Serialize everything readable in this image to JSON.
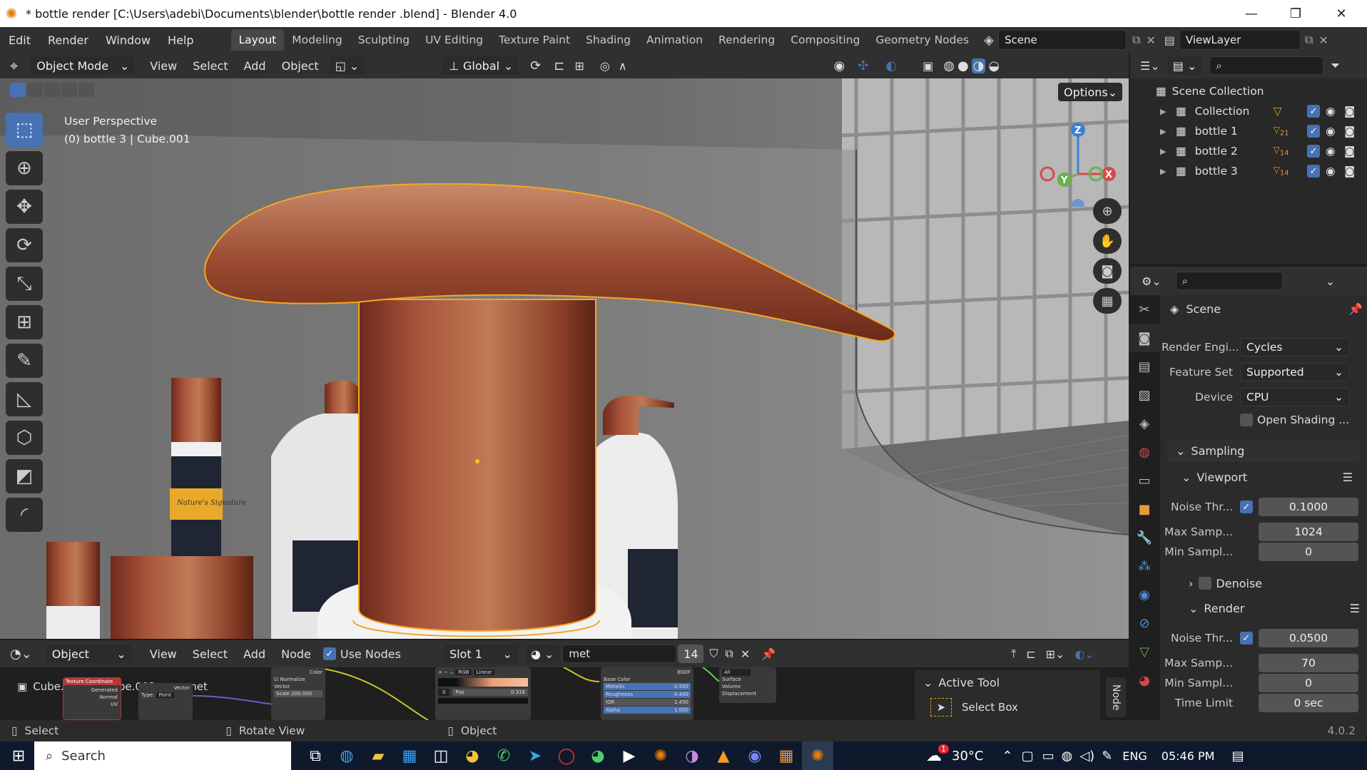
{
  "window": {
    "title": "* bottle render  [C:\\Users\\adebi\\Documents\\blender\\bottle render .blend] - Blender 4.0",
    "minimize": "—",
    "maximize": "❐",
    "close": "✕"
  },
  "menu": [
    "Edit",
    "Render",
    "Window",
    "Help"
  ],
  "workspaces": [
    "Layout",
    "Modeling",
    "Sculpting",
    "UV Editing",
    "Texture Paint",
    "Shading",
    "Animation",
    "Rendering",
    "Compositing",
    "Geometry Nodes"
  ],
  "scene_field": "Scene",
  "viewlayer_field": "ViewLayer",
  "viewport_header": {
    "mode": "Object Mode",
    "menus": [
      "View",
      "Select",
      "Add",
      "Object"
    ],
    "transform": "Global",
    "options": "Options"
  },
  "viewport": {
    "perspective": "User Perspective",
    "object_info": "(0) bottle 3  | Cube.001",
    "gizmo_z": "Z",
    "gizmo_y": "Y",
    "gizmo_x": "X",
    "label_text": "Nature's Signature"
  },
  "outliner": {
    "root": "Scene Collection",
    "items": [
      {
        "name": "Collection",
        "badge": ""
      },
      {
        "name": "bottle 1",
        "badge": "21"
      },
      {
        "name": "bottle 2",
        "badge": "14"
      },
      {
        "name": "bottle 3",
        "badge": "14"
      }
    ]
  },
  "properties": {
    "context": "Scene",
    "render_engine_label": "Render Engi...",
    "render_engine": "Cycles",
    "feature_set_label": "Feature Set",
    "feature_set": "Supported",
    "device_label": "Device",
    "device": "CPU",
    "osl_label": "Open Shading ...",
    "sampling": "Sampling",
    "viewport_panel": "Viewport",
    "vp_noise_label": "Noise Thr...",
    "vp_noise": "0.1000",
    "vp_max_label": "Max Samp...",
    "vp_max": "1024",
    "vp_min_label": "Min Sampl...",
    "vp_min": "0",
    "denoise": "Denoise",
    "render_panel": "Render",
    "r_noise_label": "Noise Thr...",
    "r_noise": "0.0500",
    "r_max_label": "Max Samp...",
    "r_max": "70",
    "r_min_label": "Min Sampl...",
    "r_min": "0",
    "time_label": "Time Limit",
    "time": "0 sec"
  },
  "node_header": {
    "type": "Object",
    "menus": [
      "View",
      "Select",
      "Add",
      "Node"
    ],
    "use_nodes": "Use Nodes",
    "slot": "Slot 1",
    "material": "met",
    "users": "14"
  },
  "node_area": {
    "breadcrumb_obj": "Cube.001",
    "breadcrumb_mesh": "Cube.002",
    "breadcrumb_mat": "met",
    "side_tab": "Node",
    "active_tool_title": "Active Tool",
    "active_tool_name": "Select Box",
    "bsdf_rows": [
      "Base Color",
      "Metallic",
      "Roughness",
      "IOR",
      "Alpha"
    ],
    "bsdf_vals": [
      "",
      "0.500",
      "0.400",
      "1.450",
      "1.000"
    ],
    "output_rows": [
      "Surface",
      "Volume",
      "Displacement"
    ],
    "ramp_label": "RGB",
    "ramp_mode": "Linear",
    "ramp_pos": "0",
    "ramp_pos_label": "Pos",
    "ramp_pos_val": "0.318",
    "mapping_rows": [
      "Generated",
      "Normal",
      "UV"
    ],
    "mapping_type_label": "Type:",
    "mapping_type": "Point",
    "mapping_vector": "Vector",
    "noise_normalize": "Normalize",
    "noise_vector": "Vector",
    "noise_scale": "Scale",
    "noise_scale_val": "200.000",
    "noise_color": "Color",
    "coord_label": "Texture Coordinate",
    "bsdf_header": "BSDF",
    "output_all": "All"
  },
  "status": {
    "left": "Select",
    "mid": "Rotate View",
    "right": "Object",
    "version": "4.0.2"
  },
  "taskbar": {
    "search": "Search",
    "temp": "30°C",
    "lang": "ENG",
    "time": "05:46 PM",
    "weather_badge": "1"
  },
  "colors": {
    "accent": "#4772b3",
    "selection": "#f5a623",
    "copper": "#b86a45"
  }
}
